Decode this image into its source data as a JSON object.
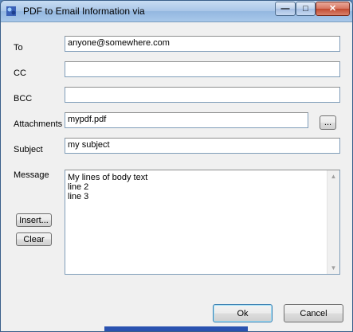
{
  "window": {
    "title": "PDF to Email Information via"
  },
  "titlebar_buttons": {
    "minimize": "—",
    "maximize": "□",
    "close": "✕"
  },
  "labels": {
    "to": "To",
    "cc": "CC",
    "bcc": "BCC",
    "attachments": "Attachments",
    "subject": "Subject",
    "message": "Message"
  },
  "fields": {
    "to": "anyone@somewhere.com",
    "cc": "",
    "bcc": "",
    "attachments": "mypdf.pdf",
    "subject": "my subject"
  },
  "message_body": "My lines of body text\nline 2\nline 3",
  "buttons": {
    "browse": "...",
    "insert": "Insert...",
    "clear": "Clear",
    "ok": "Ok",
    "cancel": "Cancel"
  },
  "scrollbar": {
    "up_arrow": "▲",
    "down_arrow": "▼"
  }
}
